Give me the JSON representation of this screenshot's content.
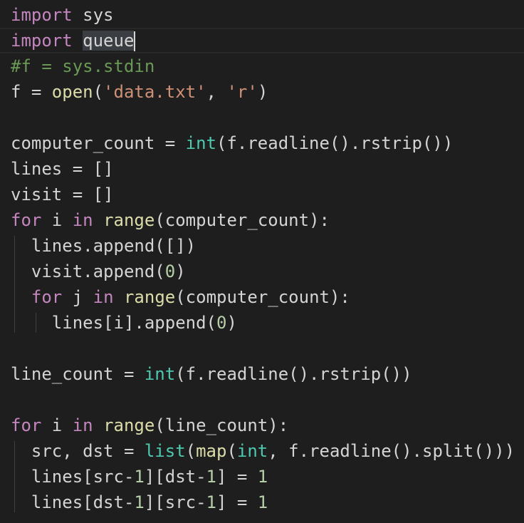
{
  "editor": {
    "lines": [
      {
        "tokens": [
          {
            "t": "import",
            "c": "kw"
          },
          {
            "t": " sys",
            "c": "id"
          }
        ]
      },
      {
        "current": true,
        "tokens": [
          {
            "t": "import",
            "c": "kw"
          },
          {
            "t": " ",
            "c": "id"
          },
          {
            "t": "queue",
            "c": "sel"
          },
          {
            "t": "",
            "c": "cursor"
          }
        ]
      },
      {
        "tokens": [
          {
            "t": "#f = sys.stdin",
            "c": "cm"
          }
        ]
      },
      {
        "tokens": [
          {
            "t": "f = ",
            "c": "id"
          },
          {
            "t": "open",
            "c": "fn"
          },
          {
            "t": "(",
            "c": "id"
          },
          {
            "t": "'data.txt'",
            "c": "str"
          },
          {
            "t": ", ",
            "c": "id"
          },
          {
            "t": "'r'",
            "c": "str"
          },
          {
            "t": ")",
            "c": "id"
          }
        ]
      },
      {
        "tokens": []
      },
      {
        "tokens": [
          {
            "t": "computer_count = ",
            "c": "id"
          },
          {
            "t": "int",
            "c": "bi"
          },
          {
            "t": "(f.readline().rstrip())",
            "c": "id"
          }
        ]
      },
      {
        "tokens": [
          {
            "t": "lines = []",
            "c": "id"
          }
        ]
      },
      {
        "tokens": [
          {
            "t": "visit = []",
            "c": "id"
          }
        ]
      },
      {
        "tokens": [
          {
            "t": "for",
            "c": "kw"
          },
          {
            "t": " i ",
            "c": "id"
          },
          {
            "t": "in",
            "c": "kw"
          },
          {
            "t": " ",
            "c": "id"
          },
          {
            "t": "range",
            "c": "fn"
          },
          {
            "t": "(computer_count):",
            "c": "id"
          }
        ]
      },
      {
        "tokens": [
          {
            "t": "  lines.append([])",
            "c": "id"
          }
        ]
      },
      {
        "tokens": [
          {
            "t": "  visit.append(",
            "c": "id"
          },
          {
            "t": "0",
            "c": "num"
          },
          {
            "t": ")",
            "c": "id"
          }
        ]
      },
      {
        "tokens": [
          {
            "t": "  ",
            "c": "id"
          },
          {
            "t": "for",
            "c": "kw"
          },
          {
            "t": " j ",
            "c": "id"
          },
          {
            "t": "in",
            "c": "kw"
          },
          {
            "t": " ",
            "c": "id"
          },
          {
            "t": "range",
            "c": "fn"
          },
          {
            "t": "(computer_count):",
            "c": "id"
          }
        ]
      },
      {
        "tokens": [
          {
            "t": "    lines[i].append(",
            "c": "id"
          },
          {
            "t": "0",
            "c": "num"
          },
          {
            "t": ")",
            "c": "id"
          }
        ]
      },
      {
        "tokens": []
      },
      {
        "tokens": [
          {
            "t": "line_count = ",
            "c": "id"
          },
          {
            "t": "int",
            "c": "bi"
          },
          {
            "t": "(f.readline().rstrip())",
            "c": "id"
          }
        ]
      },
      {
        "tokens": []
      },
      {
        "tokens": [
          {
            "t": "for",
            "c": "kw"
          },
          {
            "t": " i ",
            "c": "id"
          },
          {
            "t": "in",
            "c": "kw"
          },
          {
            "t": " ",
            "c": "id"
          },
          {
            "t": "range",
            "c": "fn"
          },
          {
            "t": "(line_count):",
            "c": "id"
          }
        ]
      },
      {
        "tokens": [
          {
            "t": "  src, dst = ",
            "c": "id"
          },
          {
            "t": "list",
            "c": "bi"
          },
          {
            "t": "(",
            "c": "id"
          },
          {
            "t": "map",
            "c": "fn"
          },
          {
            "t": "(",
            "c": "id"
          },
          {
            "t": "int",
            "c": "bi"
          },
          {
            "t": ", f.readline().split()))",
            "c": "id"
          }
        ]
      },
      {
        "tokens": [
          {
            "t": "  lines[src-",
            "c": "id"
          },
          {
            "t": "1",
            "c": "num"
          },
          {
            "t": "][dst-",
            "c": "id"
          },
          {
            "t": "1",
            "c": "num"
          },
          {
            "t": "] = ",
            "c": "id"
          },
          {
            "t": "1",
            "c": "num"
          }
        ]
      },
      {
        "tokens": [
          {
            "t": "  lines[dst-",
            "c": "id"
          },
          {
            "t": "1",
            "c": "num"
          },
          {
            "t": "][src-",
            "c": "id"
          },
          {
            "t": "1",
            "c": "num"
          },
          {
            "t": "] = ",
            "c": "id"
          },
          {
            "t": "1",
            "c": "num"
          }
        ]
      }
    ]
  },
  "colors": {
    "background": "#1e1e1e",
    "keyword": "#c586c0",
    "function": "#dcdcaa",
    "builtin_type": "#4ec9b0",
    "string": "#ce9178",
    "number": "#b5cea8",
    "comment": "#6a9955",
    "text": "#d4d4d4",
    "selection": "#3a3d41"
  }
}
